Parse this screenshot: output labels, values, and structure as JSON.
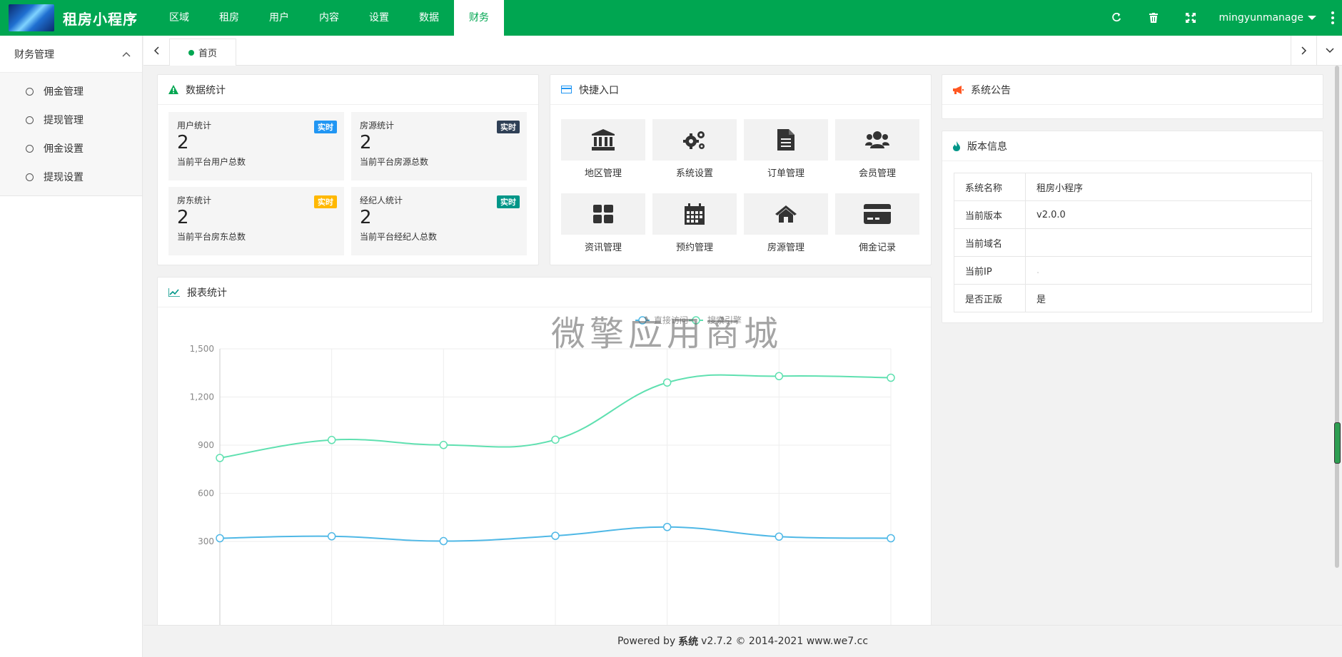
{
  "header": {
    "app_title": "租房小程序",
    "nav": [
      "区域",
      "租房",
      "用户",
      "内容",
      "设置",
      "数据",
      "财务"
    ],
    "active_nav": "财务",
    "username": "mingyunmanage"
  },
  "sidebar": {
    "section_title": "财务管理",
    "items": [
      "佣金管理",
      "提现管理",
      "佣金设置",
      "提现设置"
    ]
  },
  "tabs": {
    "home": "首页"
  },
  "stats_card": {
    "title": "数据统计",
    "items": [
      {
        "title": "用户统计",
        "badge": "实时",
        "badge_color": "#2196f3",
        "value": "2",
        "desc": "当前平台用户总数"
      },
      {
        "title": "房源统计",
        "badge": "实时",
        "badge_color": "#2f4056",
        "value": "2",
        "desc": "当前平台房源总数"
      },
      {
        "title": "房东统计",
        "badge": "实时",
        "badge_color": "#ffb800",
        "value": "2",
        "desc": "当前平台房东总数"
      },
      {
        "title": "经纪人统计",
        "badge": "实时",
        "badge_color": "#009688",
        "value": "2",
        "desc": "当前平台经纪人总数"
      }
    ]
  },
  "quick_card": {
    "title": "快捷入口",
    "items": [
      {
        "label": "地区管理",
        "icon": "bank-icon"
      },
      {
        "label": "系统设置",
        "icon": "gears-icon"
      },
      {
        "label": "订单管理",
        "icon": "document-icon"
      },
      {
        "label": "会员管理",
        "icon": "users-icon"
      },
      {
        "label": "资讯管理",
        "icon": "grid-icon"
      },
      {
        "label": "预约管理",
        "icon": "calendar-icon"
      },
      {
        "label": "房源管理",
        "icon": "home-icon"
      },
      {
        "label": "佣金记录",
        "icon": "credit-card-icon"
      }
    ]
  },
  "announce_card": {
    "title": "系统公告"
  },
  "version_card": {
    "title": "版本信息",
    "rows": [
      {
        "key": "系统名称",
        "value": "租房小程序"
      },
      {
        "key": "当前版本",
        "value": "v2.0.0"
      },
      {
        "key": "当前域名",
        "value": ""
      },
      {
        "key": "当前IP",
        "value": "."
      },
      {
        "key": "是否正版",
        "value": "是"
      }
    ]
  },
  "report_card": {
    "title": "报表统计"
  },
  "chart_data": {
    "type": "line",
    "x": [
      1,
      2,
      3,
      4,
      5,
      6,
      7
    ],
    "ylim": [
      0,
      1500
    ],
    "yticks": [
      "300",
      "600",
      "900",
      "1,200",
      "1,500"
    ],
    "legend_position": "top-center",
    "series": [
      {
        "name": "直接访问",
        "color": "#4fb8e6",
        "values": [
          320,
          332,
          302,
          335,
          390,
          330,
          320
        ]
      },
      {
        "name": "搜索引擎",
        "color": "#5fe0b0",
        "values": [
          820,
          932,
          901,
          934,
          1290,
          1330,
          1320
        ]
      }
    ]
  },
  "watermark": "微擎应用商城",
  "footer": {
    "prefix": "Powered by",
    "brand": "系统",
    "suffix": "v2.7.2 © 2014-2021 www.we7.cc"
  },
  "colors": {
    "primary": "#00a651"
  }
}
